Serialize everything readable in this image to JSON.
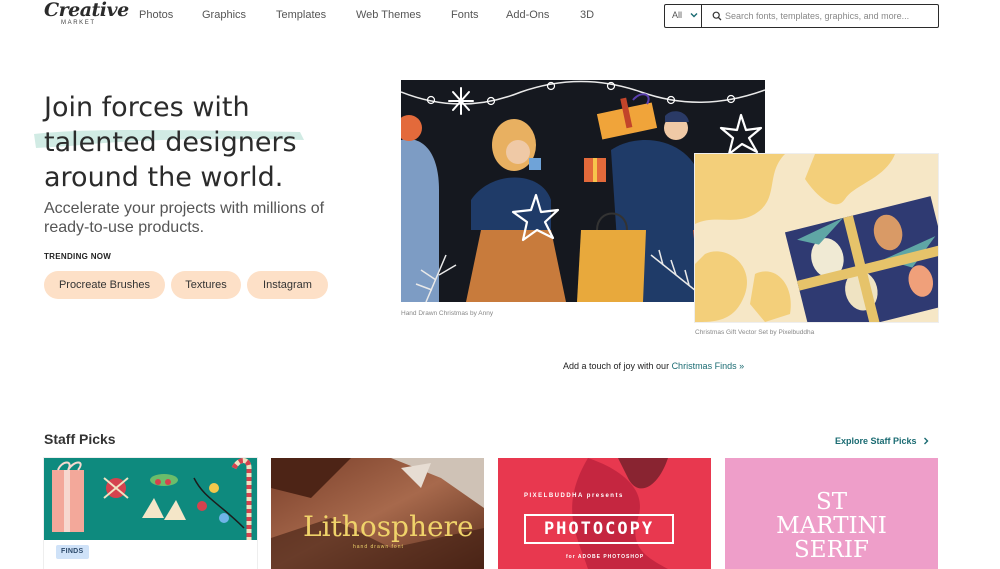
{
  "header": {
    "logo_word": "Creative",
    "logo_sub": "MARKET",
    "nav": [
      "Photos",
      "Graphics",
      "Templates",
      "Web Themes",
      "Fonts",
      "Add-Ons",
      "3D"
    ],
    "search": {
      "category": "All",
      "placeholder": "Search fonts, templates, graphics, and more..."
    }
  },
  "hero": {
    "title_lines": [
      "Join forces with",
      "talented designers",
      "around the world."
    ],
    "subtitle": "Accelerate your projects with millions of ready-to-use products.",
    "trending_label": "TRENDING NOW",
    "trending": [
      "Procreate Brushes",
      "Textures",
      "Instagram"
    ],
    "image_1_caption": "Hand Drawn Christmas by Anny",
    "image_2_caption": "Christmas Gift Vector Set by Pixelbuddha",
    "promo_text": "Add a touch of joy with our ",
    "promo_link": "Christmas Finds »"
  },
  "staff_picks": {
    "title": "Staff Picks",
    "explore": "Explore Staff Picks",
    "cards": [
      {
        "badge": "FINDS"
      },
      {
        "title": "Lithosphere",
        "subtitle": "hand drawn font"
      },
      {
        "brand": "PIXELBUDDHA presents",
        "title": "PHOTOCOPY",
        "subtitle": "for ADOBE PHOTOSHOP"
      },
      {
        "title_lines": [
          "ST",
          "MARTINI",
          "SERIF"
        ]
      }
    ]
  },
  "colors": {
    "accent_link": "#1a6b72",
    "pill_bg": "#fde0c7",
    "badge_bg": "#cfe2f8",
    "card_green": "#0e8a7e",
    "card_red": "#e8384f",
    "card_pink": "#ee9ec9",
    "hero_dark": "#15181f",
    "hero_yellow": "#f3cf7a"
  },
  "icons": {
    "search": "search-icon",
    "chevron_down": "chevron-down-icon",
    "chevron_right": "chevron-right-icon"
  }
}
